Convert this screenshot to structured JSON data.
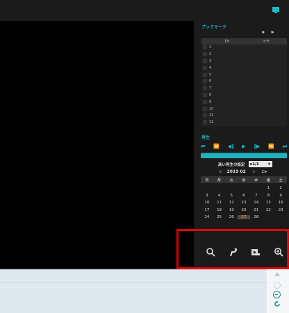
{
  "topbar": {
    "icon": "bookmark-window-icon"
  },
  "bookmark": {
    "title": "ブックマーク",
    "columns": [
      "Ch",
      "メモ"
    ],
    "rows": [
      "1",
      "2",
      "3",
      "4",
      "5",
      "6",
      "7",
      "8",
      "9",
      "10",
      "11",
      "12"
    ]
  },
  "playback": {
    "title": "再生",
    "controls": [
      "skip-start",
      "fast-rewind",
      "step-back",
      "play",
      "step-forward",
      "fast-forward",
      "skip-end"
    ],
    "progress": 1.0,
    "speed_label": "高い再生の設定",
    "speed_value": "x1/1",
    "calendar": {
      "year": "2019",
      "month": "02",
      "weekdays": [
        "日",
        "月",
        "火",
        "水",
        "木",
        "金",
        "土"
      ],
      "days": [
        "",
        "",
        "",
        "",
        "",
        "1",
        "2",
        "3",
        "4",
        "5",
        "6",
        "7",
        "8",
        "9",
        "10",
        "11",
        "12",
        "13",
        "14",
        "15",
        "16",
        "17",
        "18",
        "19",
        "20",
        "21",
        "22",
        "23",
        "24",
        "25",
        "26",
        "27",
        "28",
        "",
        ""
      ],
      "today": "27"
    }
  },
  "tools": [
    "search-icon",
    "export-icon",
    "video-playback-icon",
    "zoom-in-icon"
  ],
  "colors": {
    "accent": "#22b8c4",
    "highlight": "#e40000",
    "today": "#ff6a3a"
  }
}
